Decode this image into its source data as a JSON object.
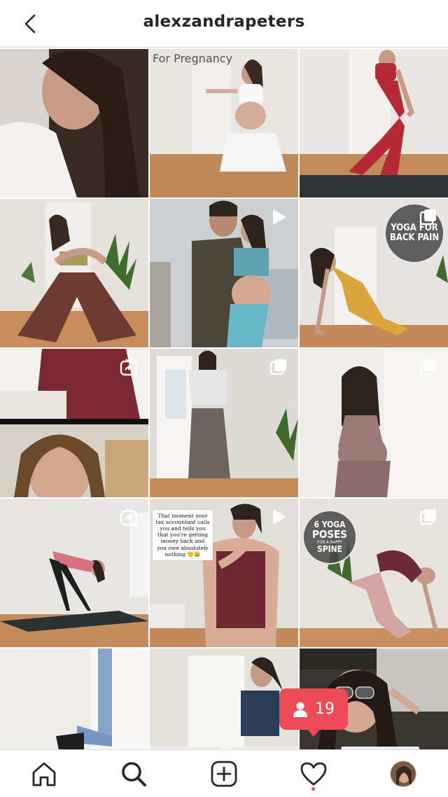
{
  "header": {
    "username": "alexzandrapeters",
    "back_icon": "chevron-left-icon"
  },
  "posts": [
    {
      "id": "p1",
      "overlay": "",
      "badge": ""
    },
    {
      "id": "p2",
      "overlay": "For Pregnancy",
      "badge": ""
    },
    {
      "id": "p3",
      "overlay": "",
      "badge": ""
    },
    {
      "id": "p4",
      "overlay": "",
      "badge": ""
    },
    {
      "id": "p5",
      "overlay": "",
      "badge": "video-icon"
    },
    {
      "id": "p6",
      "overlay_line1": "YOGA FOR",
      "overlay_line2": "BACK PAIN",
      "badge": "carousel-icon"
    },
    {
      "id": "p7",
      "overlay": "",
      "badge": "igtv-icon"
    },
    {
      "id": "p8",
      "overlay": "",
      "badge": "carousel-icon"
    },
    {
      "id": "p9",
      "overlay": "",
      "badge": "carousel-icon"
    },
    {
      "id": "p10",
      "overlay": "",
      "badge": "igtv-icon"
    },
    {
      "id": "p11",
      "note": "That moment your tax accountant calls you and tells you that you're getting money back and you owe absolutely nothing 🙂😀",
      "badge": "video-icon"
    },
    {
      "id": "p12",
      "overlay_line1": "6 YOGA",
      "overlay_line2": "POSES",
      "overlay_line3": "FOR A HAPPY",
      "overlay_line4": "SPINE",
      "badge": "carousel-icon"
    },
    {
      "id": "p13",
      "overlay": "",
      "badge": ""
    },
    {
      "id": "p14",
      "overlay": "",
      "badge": ""
    },
    {
      "id": "p15",
      "overlay": "",
      "badge": ""
    }
  ],
  "notification": {
    "icon": "user-icon",
    "count": "19",
    "color": "#ed4956"
  },
  "nav": {
    "items": [
      "home-icon",
      "search-icon",
      "new-post-icon",
      "activity-heart-icon",
      "profile-avatar"
    ],
    "active_dot_color": "#ed4956"
  },
  "colors": {
    "background": "#ffffff",
    "border": "#dbdbdb",
    "text": "#262626",
    "accent": "#ed4956"
  }
}
